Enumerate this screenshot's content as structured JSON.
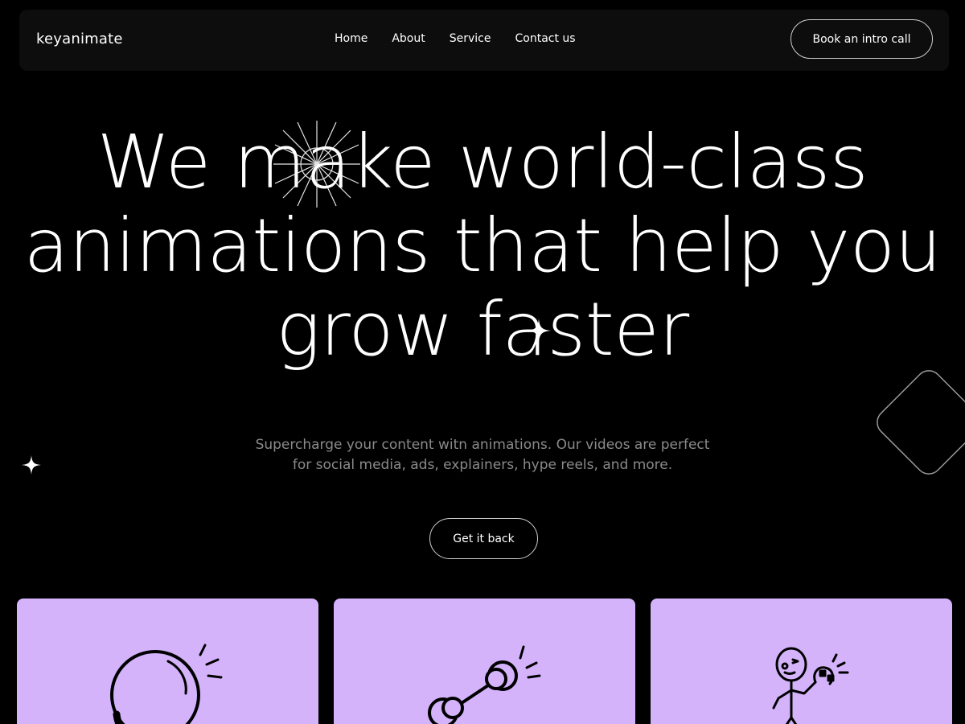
{
  "brand": {
    "name": "keyanimate"
  },
  "nav": {
    "items": [
      {
        "label": "Home"
      },
      {
        "label": "About"
      },
      {
        "label": "Service"
      },
      {
        "label": "Contact us"
      }
    ],
    "cta_label": "Book an intro call"
  },
  "hero": {
    "title_lines": [
      "We make world-class",
      "animations that help you",
      "grow faster"
    ],
    "subtitle_lines": [
      "Supercharge your content witn animations. Our videos are perfect",
      "for social media, ads, explainers, hype reels, and more."
    ],
    "button_label": "Get it back"
  },
  "cards": [
    {
      "icon": "magnifying-glass-icon"
    },
    {
      "icon": "dumbbell-icon"
    },
    {
      "icon": "stick-figure-magnet-icon"
    }
  ],
  "colors": {
    "background": "#000000",
    "navbar": "#0d0d0d",
    "card": "#d4b3fb",
    "text": "#ffffff",
    "subtitle": "#8a8a8a"
  }
}
